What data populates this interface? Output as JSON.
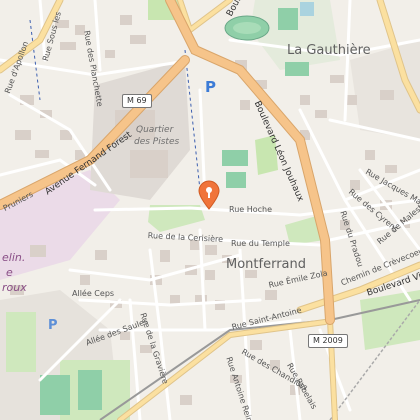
{
  "map": {
    "districts": {
      "gauthiere": "La Gauthière",
      "montferrand": "Montferrand"
    },
    "quarter": {
      "line1": "Quartier",
      "line2": "des Pistes"
    },
    "partial_labels": {
      "a": "elin.",
      "b": "e",
      "c": "roux"
    },
    "routes": {
      "m69": "M 69",
      "m2009": "M 2009"
    },
    "streets": {
      "blvd_leon_jouhaux": "Boulevard Léon Jouhaux",
      "ave_fernand_forest": "Avenue Fernand Forest",
      "rue_hoche": "Rue Hoche",
      "rue_cerisiere": "Rue de la Cerisière",
      "rue_temple": "Rue du Temple",
      "rue_emile_zola": "Rue Émile Zola",
      "rue_saint_antoine": "Rue Saint-Antoine",
      "allee_saules": "Allée des Saules",
      "allee_ceps": "Allée Ceps",
      "rue_gravière": "Rue de la Gravière",
      "rue_chandiots": "Rue des Chandiots",
      "rue_antoine_reine": "Rue Antoine Reine",
      "rue_rabelais": "Rue Rabelais",
      "rue_planchette": "Rue des Planchette",
      "rue_sous_les": "Rue Sous les",
      "rue_apollon": "Rue d'Apollon",
      "rue_pruniers": "Pruniers",
      "rue_jacques_magnier": "Rue Jacques Magnier",
      "rue_cyrens": "Rue des Cyrens",
      "rue_pradou": "Rue du Pradou",
      "rue_malestrat": "Rue de Malestrat",
      "chemin_crevecoeur": "Chemin de Crèvecoeur",
      "blvd_vir": "Boulevard Vir",
      "boulevard_top": "Boulev"
    },
    "parking_symbol": "P",
    "colors": {
      "motorway": "#f6c48a",
      "primary": "#fbe0a0",
      "water": "#aad3df",
      "park": "#c8e6b0",
      "pitch": "#8fcfa8",
      "building": "#d9d0c9",
      "marker": "#f0743a"
    }
  }
}
